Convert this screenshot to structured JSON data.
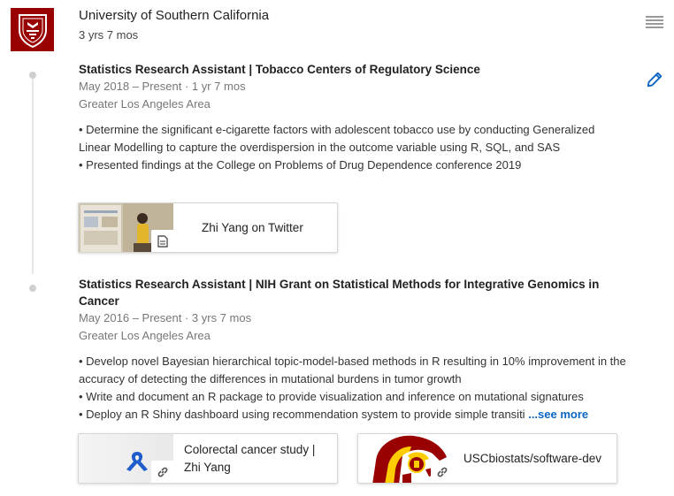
{
  "company": {
    "name": "University of Southern California",
    "duration": "3 yrs 7 mos",
    "logo_color": "#990000"
  },
  "roles": [
    {
      "title": "Statistics Research Assistant | Tobacco Centers of Regulatory Science",
      "dates": "May 2018 – Present · 1 yr 7 mos",
      "location": "Greater Los Angeles Area",
      "description": [
        "• Determine the significant e-cigarette factors with adolescent tobacco use by conducting Generalized Linear Modelling to capture the overdispersion in the outcome variable using R, SQL, and SAS",
        "• Presented findings at the College on Problems of Drug Dependence conference 2019"
      ],
      "media": [
        {
          "label": "Zhi Yang on Twitter",
          "icon": "document-icon"
        }
      ]
    },
    {
      "title": "Statistics Research Assistant | NIH Grant on Statistical Methods for Integrative Genomics in Cancer",
      "dates": "May 2016 – Present · 3 yrs 7 mos",
      "location": "Greater Los Angeles Area",
      "description": [
        "• Develop novel Bayesian hierarchical topic-model-based methods in R resulting in 10% improvement in the accuracy of detecting the differences in mutational burdens in tumor growth",
        "• Write and document an R package to provide visualization and inference on mutational signatures",
        "• Deploy an R Shiny dashboard using recommendation system to provide simple transiti"
      ],
      "see_more": "...see more",
      "media": [
        {
          "label": "Colorectal cancer study | Zhi Yang",
          "icon": "link-icon"
        },
        {
          "label": "USCbiostats/software-dev",
          "icon": "link-icon"
        }
      ]
    }
  ],
  "colors": {
    "accent": "#0a66c2",
    "usc_gold": "#ffcc00",
    "usc_cardinal": "#990000"
  }
}
